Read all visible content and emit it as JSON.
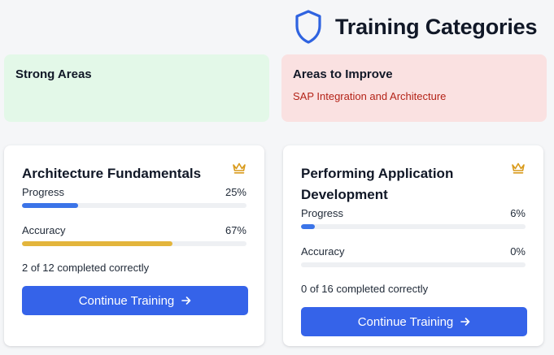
{
  "header": {
    "title": "Training Categories",
    "icon": "shield-icon"
  },
  "summary": {
    "strong": {
      "title": "Strong Areas",
      "items": []
    },
    "improve": {
      "title": "Areas to Improve",
      "items": [
        "SAP Integration and Architecture"
      ]
    }
  },
  "cards": [
    {
      "title": "Architecture Fundamentals",
      "icon": "crown-icon",
      "progress": {
        "label": "Progress",
        "value_text": "25%",
        "value": 25,
        "color": "#3b74e8"
      },
      "accuracy": {
        "label": "Accuracy",
        "value_text": "67%",
        "value": 67,
        "color": "#e3b53c"
      },
      "completed": "2 of 12 completed correctly",
      "button": "Continue Training"
    },
    {
      "title": "Performing Application Development",
      "icon": "crown-icon",
      "progress": {
        "label": "Progress",
        "value_text": "6%",
        "value": 6,
        "color": "#3b74e8"
      },
      "accuracy": {
        "label": "Accuracy",
        "value_text": "0%",
        "value": 0,
        "color": "#e3b53c"
      },
      "completed": "0 of 16 completed correctly",
      "button": "Continue Training"
    }
  ],
  "colors": {
    "accent": "#3563e9",
    "crown": "#d99a1a",
    "shield": "#2f63e0"
  }
}
